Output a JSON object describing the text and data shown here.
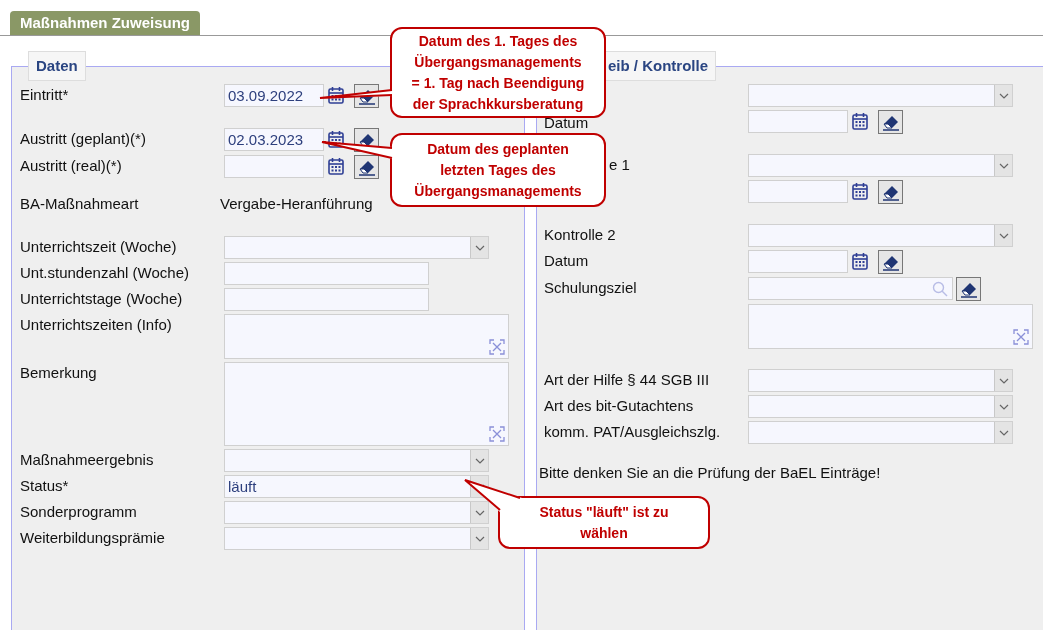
{
  "tab": {
    "label": "Maßnahmen Zuweisung",
    "selected": true
  },
  "left": {
    "legend": "Daten",
    "groups": [
      [
        {
          "label": "Eintritt*",
          "kind": "date",
          "value": "03.09.2022"
        }
      ],
      [
        {
          "label": "Austritt (geplant)(*)",
          "kind": "date",
          "value": "02.03.2023"
        },
        {
          "label": "Austritt (real)(*)",
          "kind": "date"
        }
      ],
      [
        {
          "label": "BA-Maßnahmeart",
          "kind": "text",
          "value": "Vergabe-Heranführung"
        }
      ],
      [
        {
          "label": "Unterrichtszeit (Woche)",
          "kind": "select"
        },
        {
          "label": "Unt.stundenzahl (Woche)",
          "kind": "input"
        },
        {
          "label": "Unterrichtstage (Woche)",
          "kind": "input"
        },
        {
          "label": "Unterrichtszeiten (Info)",
          "kind": "textarea"
        },
        {
          "label": "Bemerkung",
          "kind": "memo"
        },
        {
          "label": "Maßnahmeergebnis",
          "kind": "select"
        },
        {
          "label": "Status*",
          "kind": "select",
          "value": "läuft"
        },
        {
          "label": "Sonderprogramm",
          "kind": "select"
        },
        {
          "label": "Weiterbildungsprämie",
          "kind": "select"
        }
      ]
    ]
  },
  "right": {
    "legend": "eib / Kontrolle",
    "groups": [
      [
        {
          "kind": "select"
        },
        {
          "label": "Datum",
          "kind": "date"
        }
      ],
      [
        {
          "label": "e 1",
          "kind": "select"
        },
        {
          "kind": "date"
        }
      ],
      [
        {
          "label": "Kontrolle 2",
          "kind": "select"
        },
        {
          "label": "Datum",
          "kind": "date"
        },
        {
          "label": "Schulungsziel",
          "kind": "search"
        },
        {
          "kind": "textarea"
        }
      ],
      [
        {
          "label": "Art der Hilfe § 44 SGB III",
          "kind": "select"
        },
        {
          "label": "Art des bit-Gutachtens",
          "kind": "select"
        },
        {
          "label": "komm. PAT/Ausgleichszlg.",
          "kind": "select"
        }
      ]
    ],
    "note": "Bitte denken Sie an die Prüfung der BaEL Einträge!"
  },
  "callouts": [
    {
      "text": "Datum des 1. Tages des\nÜbergangsmanagements\n= 1. Tag nach Beendigung\nder Sprachkkursberatung"
    },
    {
      "text": "Datum des geplanten\nletzten Tages des\nÜbergangsmanagements"
    },
    {
      "text": "Status \"läuft\" ist zu\nwählen"
    }
  ]
}
